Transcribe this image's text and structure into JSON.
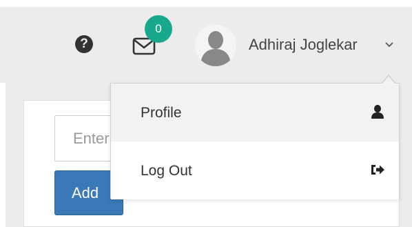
{
  "header": {
    "help_icon_glyph": "?",
    "notifications": {
      "count": "0",
      "badge_color": "#18a98d"
    },
    "user": {
      "name": "Adhiraj Joglekar"
    }
  },
  "form": {
    "input_placeholder": "Enter",
    "add_label": "Add",
    "button_color": "#3a78b8"
  },
  "user_dropdown": {
    "items": [
      {
        "label": "Profile",
        "icon": "user-icon"
      },
      {
        "label": "Log Out",
        "icon": "sign-out-icon"
      }
    ]
  }
}
